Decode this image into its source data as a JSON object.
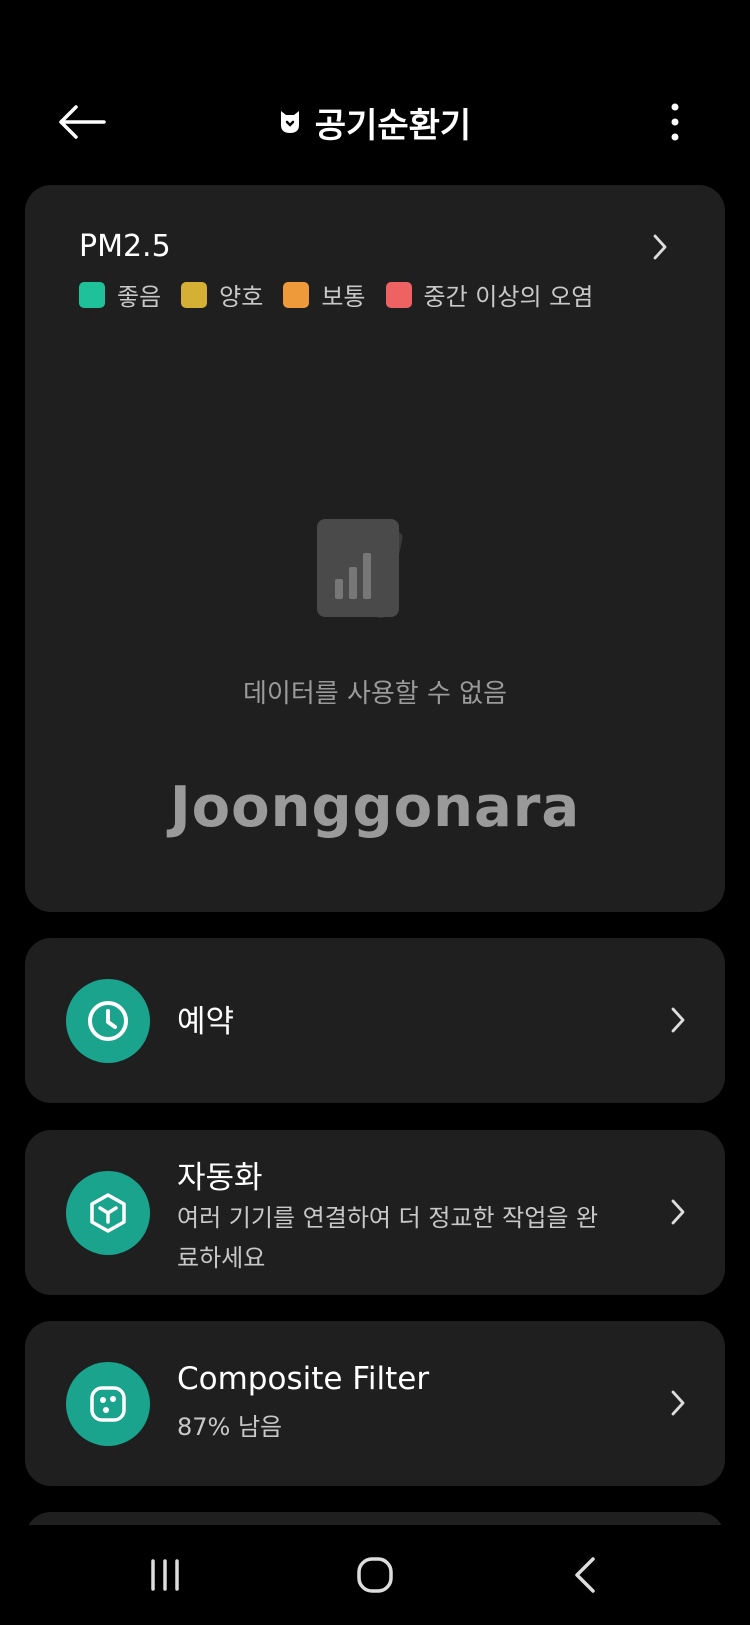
{
  "header": {
    "title": "공기순환기",
    "back_icon": "arrow-left-icon",
    "brand_icon": "mi-logo-icon",
    "more_icon": "more-vertical-icon"
  },
  "pm_card": {
    "title": "PM2.5",
    "legend": [
      {
        "label": "좋음",
        "color": "#1fc19b"
      },
      {
        "label": "양호",
        "color": "#d4b135"
      },
      {
        "label": "보통",
        "color": "#ee9a3a"
      },
      {
        "label": "중간 이상의 오염",
        "color": "#ef6263"
      }
    ],
    "empty_text": "데이터를 사용할 수 없음",
    "watermark": "Joonggonara"
  },
  "rows": [
    {
      "title": "예약",
      "icon": "clock-icon"
    },
    {
      "title": "자동화",
      "subtitle": "여러 기기를 연결하여 더 정교한 작업을 완료하세요",
      "icon": "cube-icon"
    },
    {
      "title": "Composite Filter",
      "subtitle": "87% 남음",
      "icon": "filter-icon"
    }
  ],
  "colors": {
    "accent": "#1aa48d",
    "card_bg": "#1f1f1f",
    "background": "#000000"
  },
  "navbar": {
    "recent_icon": "recent-apps-icon",
    "home_icon": "home-icon",
    "back_icon": "nav-back-icon"
  }
}
